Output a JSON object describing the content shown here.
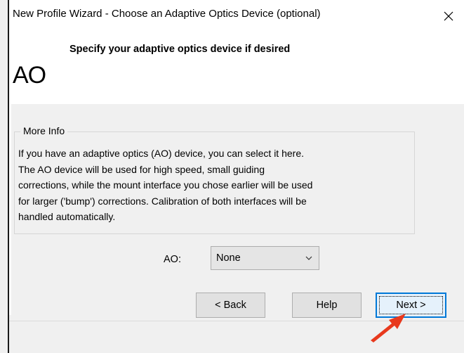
{
  "window": {
    "title": "New Profile Wizard - Choose an Adaptive Optics Device (optional)"
  },
  "header": {
    "logo_text": "AO",
    "heading": "Specify your adaptive optics device if desired"
  },
  "more_info": {
    "legend": "More Info",
    "lines": [
      "If you have an adaptive optics (AO) device, you can select it here.",
      "The AO device will be used for high speed, small guiding",
      "corrections, while the mount interface you chose earlier will be used",
      "for larger ('bump') corrections. Calibration of both interfaces will be",
      "handled automatically."
    ]
  },
  "ao_field": {
    "label": "AO:",
    "selected": "None"
  },
  "buttons": {
    "back": "< Back",
    "help": "Help",
    "next": "Next >"
  },
  "colors": {
    "focus_border": "#0078d7",
    "annotation_arrow": "#e8391d"
  }
}
